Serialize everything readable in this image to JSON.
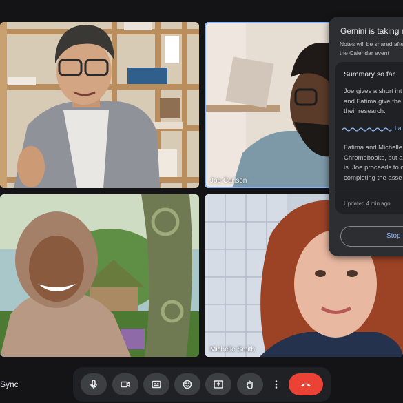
{
  "participants": [
    {
      "id": "p1",
      "name": ""
    },
    {
      "id": "p2",
      "name": "Joe Carlson",
      "active": true
    },
    {
      "id": "p3",
      "name": ""
    },
    {
      "id": "p4",
      "name": "Michelle Smith"
    }
  ],
  "bottom_bar": {
    "left_label": "Sync",
    "controls": [
      {
        "name": "microphone",
        "icon": "mic-icon"
      },
      {
        "name": "camera",
        "icon": "camera-icon"
      },
      {
        "name": "captions",
        "icon": "captions-icon"
      },
      {
        "name": "emoji",
        "icon": "emoji-icon"
      },
      {
        "name": "present",
        "icon": "present-icon"
      },
      {
        "name": "raise-hand",
        "icon": "hand-icon"
      },
      {
        "name": "more-options",
        "icon": "more-vert-icon"
      },
      {
        "name": "leave-call",
        "icon": "phone-hangup-icon"
      }
    ]
  },
  "gemini_panel": {
    "title": "Gemini is taking n",
    "subtitle_line1": "Notes will be shared afte",
    "subtitle_line2": "the Calendar event",
    "summary_title": "Summary so far",
    "paragraph1": "Joe gives a short int\nand Fatima give the\ntheir research.",
    "latest_label": "Lat",
    "paragraph2": "Fatima and Michelle\nChromebooks, but a\nis. Joe proceeds to c\ncompleting the asse",
    "updated": "Updated 4 min ago",
    "stop_label": "Stop"
  },
  "colors": {
    "background": "#141416",
    "active_speaker_border": "#8ab4f8",
    "leave_button": "#ea4335",
    "panel_bg": "#2d2e31",
    "accent_text": "#8ab4f8"
  }
}
